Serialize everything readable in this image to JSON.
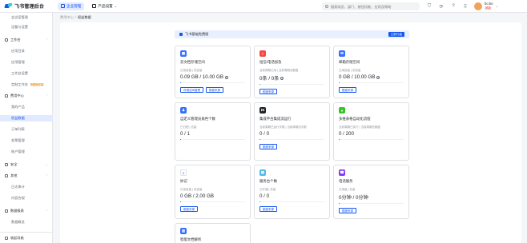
{
  "header": {
    "logo_text": "飞书管理后台",
    "nav": [
      {
        "label": "企业管理",
        "icon": "building-icon",
        "active": true
      },
      {
        "label": "产品设置",
        "icon": "grid-icon",
        "active": false
      }
    ],
    "search_placeholder": "搜索成员、部门、按钮功能、应用及帮助",
    "icons": [
      "shield-icon",
      "refresh-icon",
      "help-icon",
      "bell-icon",
      "apps-icon"
    ],
    "user": {
      "name": "bo bo",
      "badge": "超级"
    }
  },
  "sidebar": {
    "rows": [
      {
        "label": "会议室管理",
        "kind": "child"
      },
      {
        "label": "设备与设置",
        "kind": "child"
      },
      {
        "label": "工作台",
        "kind": "group",
        "icon": "workbench-icon"
      },
      {
        "label": "应用目录",
        "kind": "child"
      },
      {
        "label": "应用管理",
        "kind": "child"
      },
      {
        "label": "工作台设置",
        "kind": "child"
      },
      {
        "label": "定制工作台",
        "kind": "child",
        "tag": "专属版可用"
      },
      {
        "label": "费用中心",
        "kind": "group",
        "icon": "wallet-icon"
      },
      {
        "label": "我的产品",
        "kind": "child"
      },
      {
        "label": "权益数据",
        "kind": "child",
        "active": true
      },
      {
        "label": "订单列表",
        "kind": "child"
      },
      {
        "label": "发票管理",
        "kind": "child"
      },
      {
        "label": "账户管理",
        "kind": "child"
      },
      {
        "label": "安全",
        "kind": "group",
        "icon": "shield-icon"
      },
      {
        "label": "其他",
        "kind": "group",
        "icon": "more-icon"
      },
      {
        "label": "日志审计",
        "kind": "child"
      },
      {
        "label": "内容合规",
        "kind": "child"
      },
      {
        "label": "数据报表",
        "kind": "group",
        "icon": "report-icon"
      },
      {
        "label": "数据概览",
        "kind": "child"
      }
    ],
    "footer": "收起导航"
  },
  "breadcrumb": {
    "parent": "费用中心",
    "sep": "/",
    "current": "权益数据"
  },
  "banner": {
    "text": "飞书基础免费版",
    "button": "立即升级"
  },
  "cards": [
    {
      "title": "云文档存储空间",
      "icon_label": "▦",
      "color": "#3370ff",
      "meta": "已用容量 | 总容量",
      "value": "0.09 GB / 10.00 GB",
      "info": true,
      "fill": 0.009,
      "buttons": [
        "存储空间管理",
        "额度来源"
      ]
    },
    {
      "title": "短信/电话加急",
      "icon_label": "!",
      "color": "#f54a45",
      "meta": "当前周期已用 | 当前周期总额度",
      "value": "0条 / 0条",
      "info": true,
      "fill": 0,
      "buttons": [
        "额度来源"
      ]
    },
    {
      "title": "邮箱存储空间",
      "icon_label": "✉",
      "color": "#3370ff",
      "meta": "已用容量 | 总容量",
      "value": "0 GB / 10.00 GB",
      "info": true,
      "fill": 0,
      "buttons": [
        "额度来源"
      ]
    },
    {
      "title": "自定义管理员角色个数",
      "icon_label": "♟",
      "color": "#3370ff",
      "meta": "已分配 | 总量",
      "value": "0 / 1",
      "info": false,
      "fill": 0,
      "buttons": []
    },
    {
      "title": "集成平台集成流运行",
      "icon_label": "⋈",
      "color": "#1f2329",
      "meta": "当前周期已运行次数 | 当前周期总次数",
      "value": "0 / 0",
      "info": false,
      "fill": 0,
      "buttons": [
        "额度来源"
      ]
    },
    {
      "title": "多维表格自动化流程",
      "icon_label": "●",
      "color": "#34c724",
      "meta": "当前周期已执行 | 当前周期总额度",
      "value": "0 / 200",
      "info": false,
      "fill": 0,
      "buttons": []
    },
    {
      "title": "妙记",
      "icon_label": "≈",
      "color": "#ffffff",
      "meta": "已用容量 | 总容量",
      "value": "0 GB / 2.00 GB",
      "info": false,
      "fill": 0,
      "buttons": [
        "额度来源"
      ]
    },
    {
      "title": "服务台个数",
      "icon_label": "▤",
      "color": "#4fb9e8",
      "meta": "已开通 | 总量",
      "value": "0 / 0",
      "info": false,
      "fill": 0,
      "buttons": [
        "额度来源"
      ]
    },
    {
      "title": "电话服务",
      "icon_label": "☎",
      "color": "#7f3bf5",
      "meta": "已用量 | 总量",
      "value": "0分钟 / 0分钟",
      "info": false,
      "fill": 0,
      "buttons": [
        "额度来源"
      ]
    },
    {
      "title": "智能文档解析",
      "icon_label": "▥",
      "color": "#3370ff",
      "meta": "",
      "value": "",
      "info": false,
      "fill": 0,
      "buttons": []
    }
  ]
}
